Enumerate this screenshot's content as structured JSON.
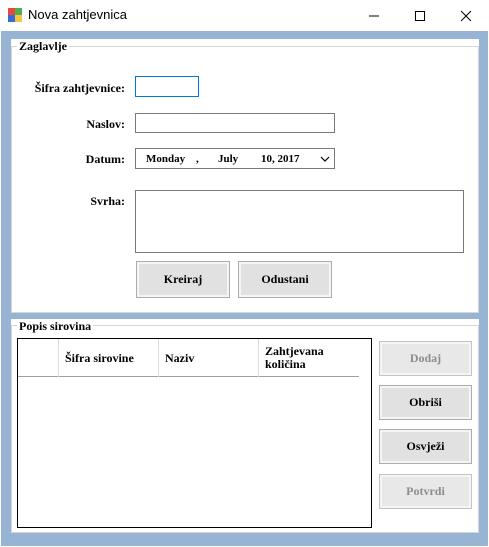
{
  "window": {
    "title": "Nova zahtjevnica",
    "controls": {
      "minimize": "—",
      "maximize": "☐",
      "close": "✕"
    }
  },
  "header_group": {
    "title": "Zaglavlje",
    "sifra_label": "Šifra zahtjevnice:",
    "sifra_value": "",
    "naslov_label": "Naslov:",
    "naslov_value": "",
    "datum_label": "Datum:",
    "date": {
      "weekday": "Monday",
      "sep": ",",
      "month": "July",
      "day_year": "10, 2017"
    },
    "svrha_label": "Svrha:",
    "svrha_value": "",
    "kreiraj_button": "Kreiraj",
    "odustani_button": "Odustani"
  },
  "materials_group": {
    "title": "Popis sirovina",
    "columns": [
      "Šifra sirovine",
      "Naziv",
      "Zahtjevana količina"
    ],
    "rows": [],
    "buttons": {
      "dodaj": "Dodaj",
      "obrisi": "Obriši",
      "osvjezi": "Osvježi",
      "potvrdi": "Potvrdi"
    }
  },
  "colors": {
    "client_background": "#98b4d4",
    "input_border": "#0078d7"
  }
}
